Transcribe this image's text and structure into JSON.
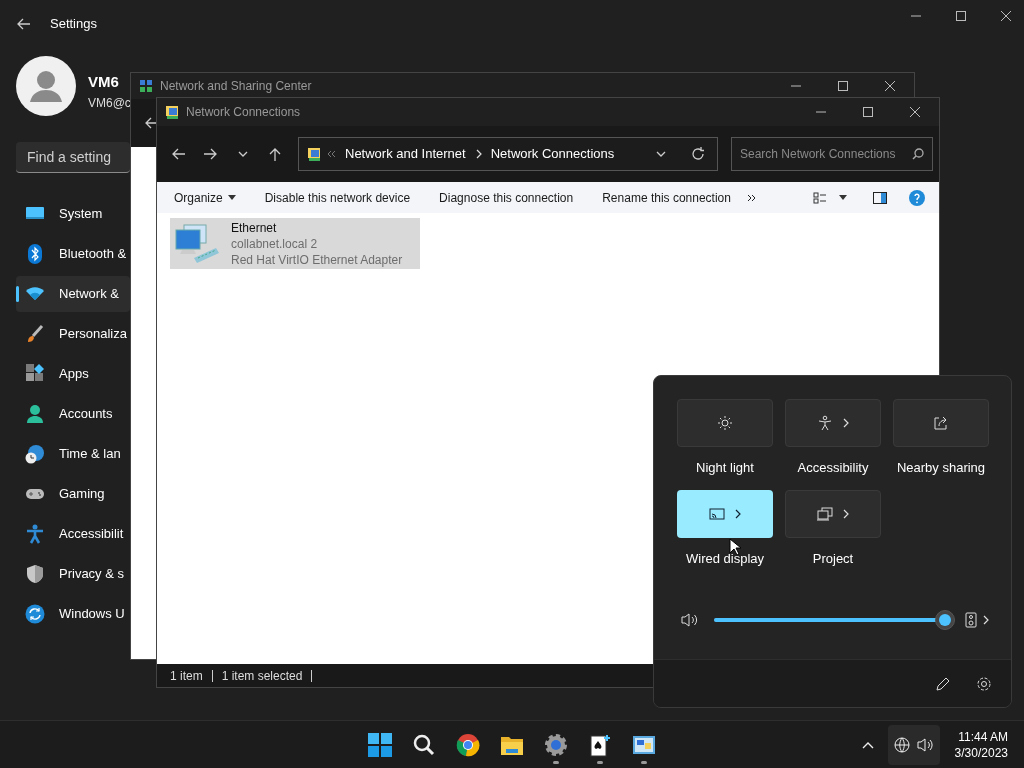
{
  "settings": {
    "title": "Settings",
    "user": {
      "name": "VM6",
      "email": "VM6@c"
    },
    "search": {
      "placeholder": "Find a setting"
    },
    "nav": [
      {
        "label": "System",
        "kind": "system",
        "selected": false
      },
      {
        "label": "Bluetooth &",
        "kind": "bluetooth",
        "selected": false
      },
      {
        "label": "Network &",
        "kind": "network",
        "selected": true
      },
      {
        "label": "Personaliza",
        "kind": "brush",
        "selected": false
      },
      {
        "label": "Apps",
        "kind": "apps",
        "selected": false
      },
      {
        "label": "Accounts",
        "kind": "accounts",
        "selected": false
      },
      {
        "label": "Time & lan",
        "kind": "time",
        "selected": false
      },
      {
        "label": "Gaming",
        "kind": "gaming",
        "selected": false
      },
      {
        "label": "Accessibilit",
        "kind": "accessibility",
        "selected": false
      },
      {
        "label": "Privacy & s",
        "kind": "privacy",
        "selected": false
      },
      {
        "label": "Windows U",
        "kind": "update",
        "selected": false
      }
    ]
  },
  "sharing_center": {
    "title": "Network and Sharing Center"
  },
  "connections": {
    "title": "Network Connections",
    "breadcrumb": [
      "Network and Internet",
      "Network Connections"
    ],
    "search": {
      "placeholder": "Search Network Connections"
    },
    "commands": [
      {
        "label": "Organize",
        "kind": "menu"
      },
      {
        "label": "Disable this network device",
        "kind": "action"
      },
      {
        "label": "Diagnose this connection",
        "kind": "action"
      },
      {
        "label": "Rename this connection",
        "kind": "action"
      }
    ],
    "items": [
      {
        "name": "Ethernet",
        "network": "collabnet.local 2",
        "device": "Red Hat VirtIO Ethernet Adapter",
        "selected": true
      }
    ],
    "status": [
      "1 item",
      "1 item selected"
    ]
  },
  "quick_settings": {
    "tiles": [
      {
        "label": "Night light",
        "kind": "sun",
        "on": false,
        "expandable": false
      },
      {
        "label": "Accessibility",
        "kind": "person",
        "on": false,
        "expandable": true
      },
      {
        "label": "Nearby sharing",
        "kind": "share",
        "on": false,
        "expandable": false
      },
      {
        "label": "Wired display",
        "kind": "cast",
        "on": true,
        "expandable": true
      },
      {
        "label": "Project",
        "kind": "project",
        "on": false,
        "expandable": true
      }
    ],
    "volume": {
      "level": 1
    }
  },
  "taskbar": {
    "apps": [
      {
        "kind": "start",
        "running": false
      },
      {
        "kind": "search",
        "running": false
      },
      {
        "kind": "browser",
        "running": false
      },
      {
        "kind": "folder",
        "running": false
      },
      {
        "kind": "settings",
        "running": true
      },
      {
        "kind": "cards",
        "running": true
      },
      {
        "kind": "network",
        "running": true
      }
    ],
    "time": "11:44 AM",
    "date": "3/30/2023"
  }
}
